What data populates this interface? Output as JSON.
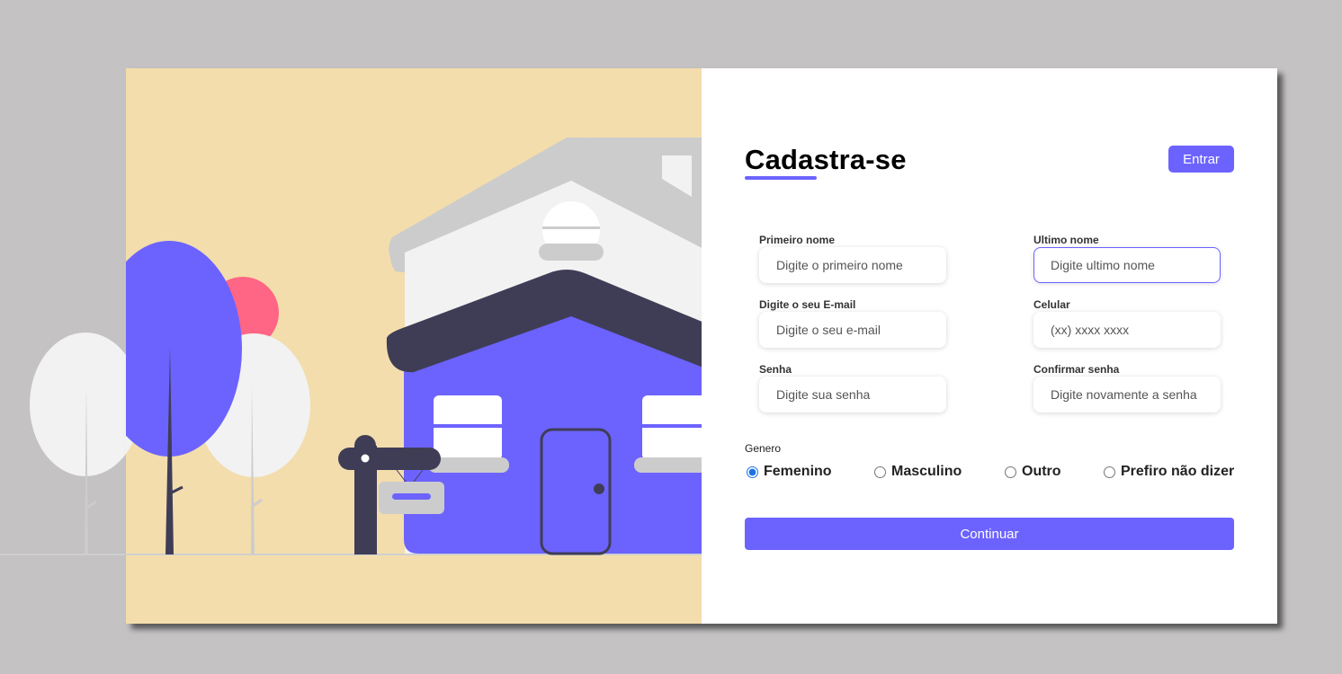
{
  "form": {
    "title": "Cadastra-se",
    "login_label": "Entrar",
    "fields": [
      {
        "label": "Primeiro nome",
        "placeholder": "Digite o primeiro nome",
        "value": ""
      },
      {
        "label": "Ultimo nome",
        "placeholder": "Digite ultimo nome",
        "value": ""
      },
      {
        "label": "Digite o seu E-mail",
        "placeholder": "Digite o seu e-mail",
        "value": ""
      },
      {
        "label": "Celular",
        "placeholder": "(xx) xxxx xxxx",
        "value": ""
      },
      {
        "label": "Senha",
        "placeholder": "Digite sua senha",
        "value": ""
      },
      {
        "label": "Confirmar senha",
        "placeholder": "Digite novamente a senha",
        "value": ""
      }
    ],
    "gender": {
      "title": "Genero",
      "options": [
        "Femenino",
        "Masculino",
        "Outro",
        "Prefiro não dizer"
      ],
      "selected": "Femenino"
    },
    "continue_label": "Continuar"
  },
  "colors": {
    "accent": "#6c63ff",
    "illustration_bg": "#f3ddac",
    "page_bg": "#c4c2c3",
    "dark": "#3f3d56",
    "pink": "#ff6584",
    "light_gray": "#f2f2f2",
    "gray": "#cccccc"
  },
  "icons": [
    "house-illustration",
    "tree-illustration",
    "mailbox-illustration",
    "radio-selected-icon",
    "radio-unselected-icon"
  ]
}
